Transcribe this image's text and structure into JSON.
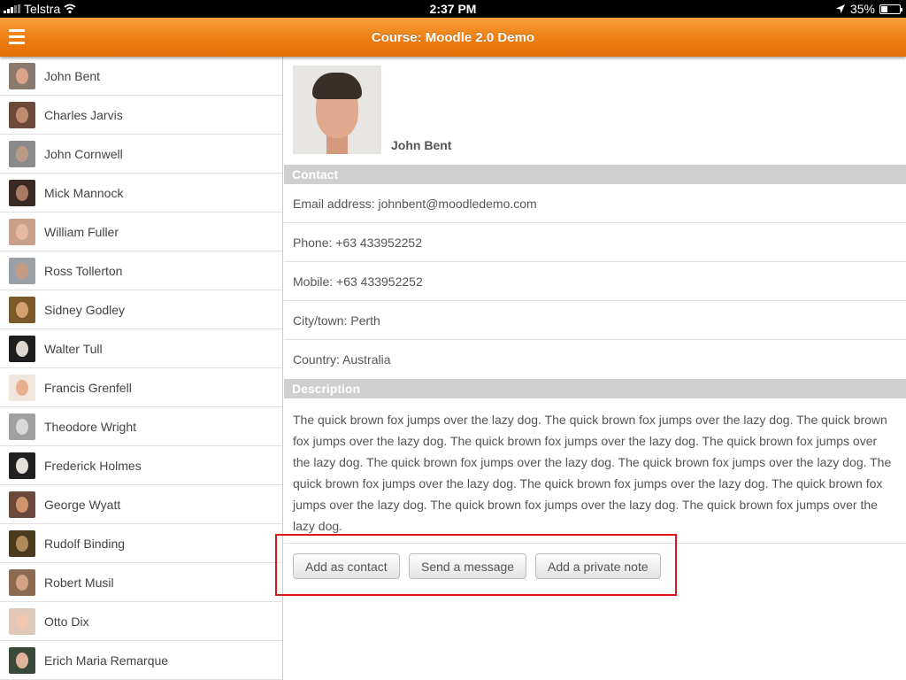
{
  "status_bar": {
    "carrier": "Telstra",
    "time": "2:37 PM",
    "battery": "35%",
    "battery_level": 0.35
  },
  "header": {
    "title": "Course: Moodle 2.0 Demo",
    "menu_icon": "hamburger-menu-icon"
  },
  "sidebar": {
    "users": [
      {
        "name": "John Bent",
        "bg": "#8a7a6e",
        "face": "#d9a48a"
      },
      {
        "name": "Charles Jarvis",
        "bg": "#6b4a3a",
        "face": "#c08a6e"
      },
      {
        "name": "John Cornwell",
        "bg": "#8a8a8a",
        "face": "#b89a86"
      },
      {
        "name": "Mick Mannock",
        "bg": "#3a2a24",
        "face": "#a87a62"
      },
      {
        "name": "William Fuller",
        "bg": "#c9a08a",
        "face": "#e8b8a0"
      },
      {
        "name": "Ross Tollerton",
        "bg": "#9aa0a6",
        "face": "#c49a80"
      },
      {
        "name": "Sidney Godley",
        "bg": "#7a5a2a",
        "face": "#d4a070"
      },
      {
        "name": "Walter Tull",
        "bg": "#1e1e1e",
        "face": "#e0d8d0"
      },
      {
        "name": "Francis Grenfell",
        "bg": "#f0e6dc",
        "face": "#e8b090"
      },
      {
        "name": "Theodore Wright",
        "bg": "#a0a0a0",
        "face": "#d8d8d8"
      },
      {
        "name": "Frederick Holmes",
        "bg": "#202020",
        "face": "#e6e0da"
      },
      {
        "name": "George Wyatt",
        "bg": "#6a4a3a",
        "face": "#d0946e"
      },
      {
        "name": "Rudolf Binding",
        "bg": "#4a3a1e",
        "face": "#b08a5a"
      },
      {
        "name": "Robert Musil",
        "bg": "#8a6a50",
        "face": "#d4a284"
      },
      {
        "name": "Otto Dix",
        "bg": "#e0c8b8",
        "face": "#f0c8b0"
      },
      {
        "name": "Erich Maria Remarque",
        "bg": "#3a4a3a",
        "face": "#e0b49a"
      }
    ]
  },
  "profile": {
    "name": "John Bent"
  },
  "contact": {
    "header": "Contact",
    "rows": [
      "Email address: johnbent@moodledemo.com",
      "Phone: +63 433952252",
      "Mobile: +63 433952252",
      "City/town: Perth",
      "Country: Australia"
    ]
  },
  "description": {
    "header": "Description",
    "text": "The quick brown fox jumps over the lazy dog. The quick brown fox jumps over the lazy dog. The quick brown fox jumps over the lazy dog. The quick brown fox jumps over the lazy dog. The quick brown fox jumps over the lazy dog. The quick brown fox jumps over the lazy dog. The quick brown fox jumps over the lazy dog. The quick brown fox jumps over the lazy dog. The quick brown fox jumps over the lazy dog. The quick brown fox jumps over the lazy dog. The quick brown fox jumps over the lazy dog. The quick brown fox jumps over the lazy dog."
  },
  "actions": {
    "add_contact": "Add as contact",
    "send_message": "Send a message",
    "add_note": "Add a private note",
    "highlight_color": "#e0141b"
  }
}
